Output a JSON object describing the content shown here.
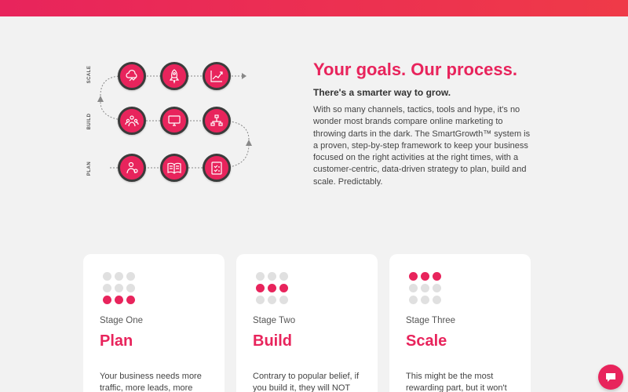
{
  "diagram": {
    "rows": [
      {
        "label": "SCALE",
        "icons": [
          "cloud-chart-icon",
          "rocket-icon",
          "growth-chart-icon"
        ]
      },
      {
        "label": "BUILD",
        "icons": [
          "team-icon",
          "devices-icon",
          "sitemap-icon"
        ]
      },
      {
        "label": "PLAN",
        "icons": [
          "user-target-icon",
          "book-icon",
          "checklist-icon"
        ]
      }
    ]
  },
  "intro": {
    "headline": "Your goals. Our process.",
    "subhead": "There's a smarter way to grow.",
    "body": "With so many channels, tactics, tools and hype, it's no wonder most brands compare online marketing to throwing darts in the dark. The SmartGrowth™ system is a proven, step-by-step framework to keep your business focused on the right activities at the right times, with a customer-centric, data-driven strategy to plan, build and scale. Predictably."
  },
  "cards": [
    {
      "stage": "Stage One",
      "title": "Plan",
      "text": "Your business needs more traffic, more leads, more"
    },
    {
      "stage": "Stage Two",
      "title": "Build",
      "text": "Contrary to popular belief, if you build it, they will NOT"
    },
    {
      "stage": "Stage Three",
      "title": "Scale",
      "text": "This might be the most rewarding part, but it won't"
    }
  ],
  "colors": {
    "accent": "#e8245c",
    "background": "#f2f2f2"
  },
  "chat": {
    "icon": "chat-bubble-icon"
  }
}
